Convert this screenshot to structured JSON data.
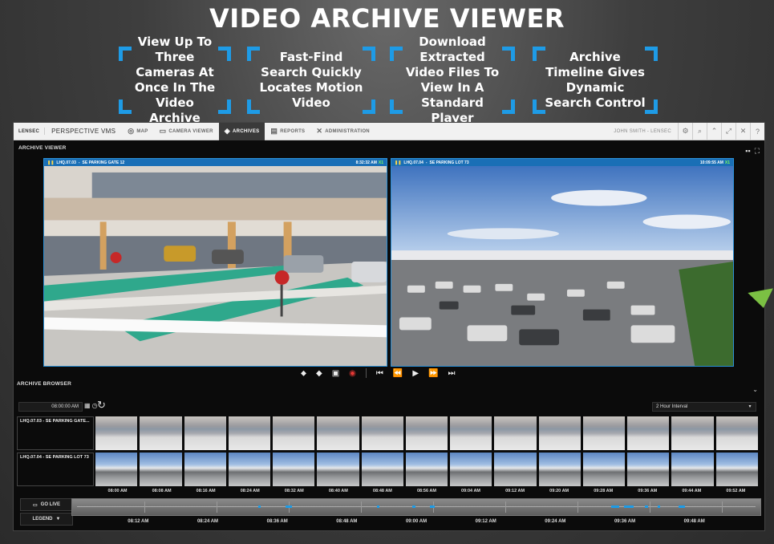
{
  "banner": {
    "title": "VIDEO ARCHIVE VIEWER",
    "features": [
      "View Up To Three Cameras At Once In The Video Archive",
      "Fast-Find Search Quickly Locates Motion Video",
      "Download Extracted Video Files To View In A Standard Player",
      "Archive Timeline Gives Dynamic Search Control"
    ]
  },
  "nav": {
    "logo": "LENSEC",
    "app_name": "PERSPECTIVE VMS",
    "items": [
      {
        "label": "MAP",
        "icon": "globe-icon"
      },
      {
        "label": "CAMERA VIEWER",
        "icon": "monitor-icon"
      },
      {
        "label": "ARCHIVES",
        "icon": "archive-icon"
      },
      {
        "label": "REPORTS",
        "icon": "document-icon"
      },
      {
        "label": "ADMINISTRATION",
        "icon": "tools-icon"
      }
    ],
    "active": "ARCHIVES",
    "user": "JOHN SMITH - LENSEC"
  },
  "viewer": {
    "label": "ARCHIVE VIEWER",
    "cameras": [
      {
        "id": "LHQ.07.03",
        "name": "SE PARKING GATE 12",
        "timestamp": "8:32:32 AM",
        "speed": "X1"
      },
      {
        "id": "LHQ.07.04",
        "name": "SE PARKING LOT 73",
        "timestamp": "10:09:55 AM",
        "speed": "X1"
      }
    ]
  },
  "browser": {
    "label": "ARCHIVE BROWSER",
    "time": "08:00:00 AM",
    "interval": "2 Hour Interval",
    "rows": [
      {
        "label": "LHQ.07.03 - SE PARKING GATE..."
      },
      {
        "label": "LHQ.07.04 - SE PARKING LOT 73"
      }
    ],
    "hour_labels": [
      "08:00 AM",
      "08:08 AM",
      "08:16 AM",
      "08:24 AM",
      "08:32 AM",
      "08:40 AM",
      "08:48 AM",
      "08:56 AM",
      "09:04 AM",
      "09:12 AM",
      "09:20 AM",
      "09:28 AM",
      "09:36 AM",
      "09:44 AM",
      "09:52 AM"
    ]
  },
  "timeline": {
    "go_live": "GO LIVE",
    "legend": "LEGEND",
    "labels": [
      "08:12 AM",
      "08:24 AM",
      "08:36 AM",
      "08:48 AM",
      "09:00 AM",
      "09:12 AM",
      "09:24 AM",
      "09:36 AM",
      "09:48 AM"
    ]
  },
  "colors": {
    "accent": "#1e9be6",
    "title_bar": "#1a6fb6",
    "arrow": "#7bc043"
  }
}
